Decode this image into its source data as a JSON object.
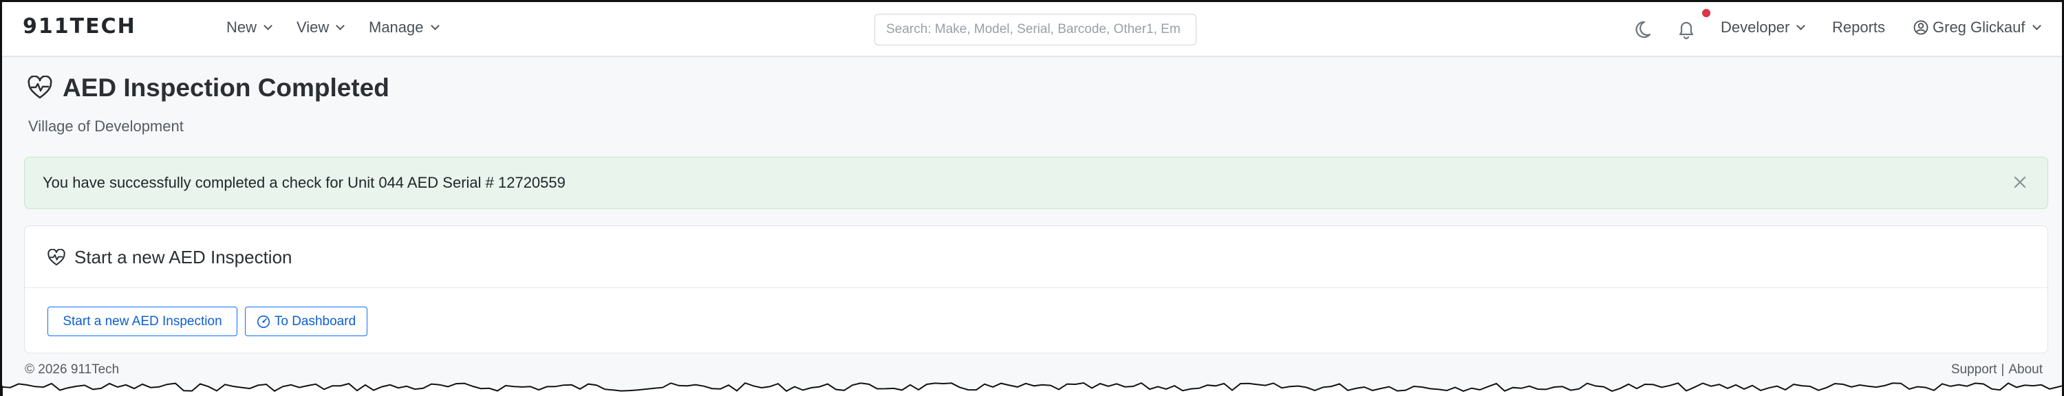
{
  "navbar": {
    "brand": "911TECH",
    "menu": [
      {
        "label": "New"
      },
      {
        "label": "View"
      },
      {
        "label": "Manage"
      }
    ],
    "search_placeholder": "Search: Make, Model, Serial, Barcode, Other1, Em",
    "right_menu": {
      "developer": "Developer",
      "reports": "Reports",
      "user": "Greg Glickauf"
    },
    "icons": {
      "theme": "moon-icon",
      "notifications": "bell-icon",
      "user": "user-circle-icon"
    },
    "notification_dot_color": "#dc3545"
  },
  "page": {
    "title": "AED Inspection Completed",
    "title_icon": "heart-pulse-icon",
    "organization": "Village of Development"
  },
  "alert": {
    "message": "You have successfully completed a check for Unit 044 AED Serial # 12720559",
    "close_icon": "close-icon",
    "color": "#e9f4ec"
  },
  "card": {
    "title": "Start a new AED Inspection",
    "title_icon": "heart-pulse-icon",
    "buttons": {
      "start": "Start a new AED Inspection",
      "dashboard": "To Dashboard"
    },
    "accent_color": "#0d6efd"
  },
  "footer": {
    "copyright": "© 2026 911Tech",
    "support": "Support",
    "separator": "|",
    "about": "About"
  }
}
